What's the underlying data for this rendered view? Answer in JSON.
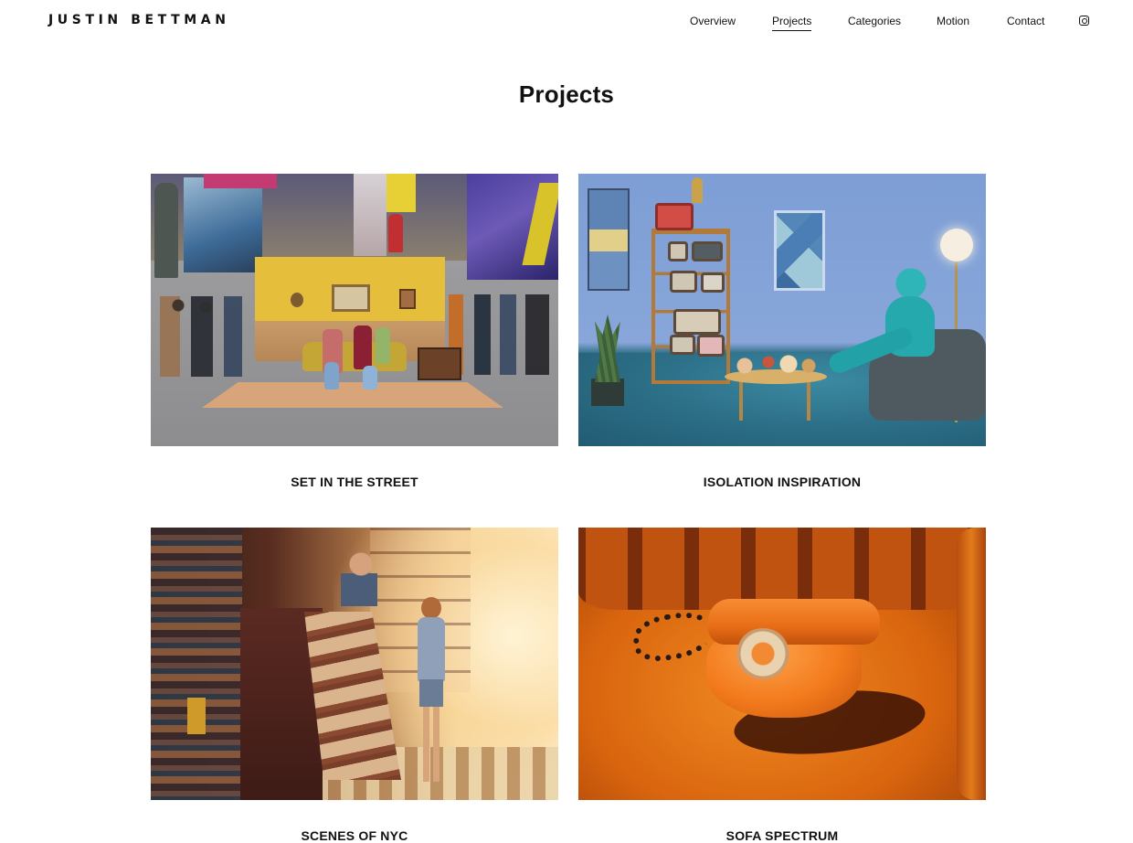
{
  "header": {
    "logo": "JUSTIN BETTMAN",
    "nav": [
      {
        "label": "Overview",
        "active": false
      },
      {
        "label": "Projects",
        "active": true
      },
      {
        "label": "Categories",
        "active": false
      },
      {
        "label": "Motion",
        "active": false
      },
      {
        "label": "Contact",
        "active": false
      }
    ],
    "social_icon": "instagram-icon"
  },
  "page": {
    "title": "Projects"
  },
  "projects": [
    {
      "title": "SET IN THE STREET"
    },
    {
      "title": "ISOLATION INSPIRATION"
    },
    {
      "title": "SCENES OF NYC"
    },
    {
      "title": "SOFA SPECTRUM"
    }
  ],
  "colors": {
    "text": "#111111",
    "background": "#ffffff"
  }
}
